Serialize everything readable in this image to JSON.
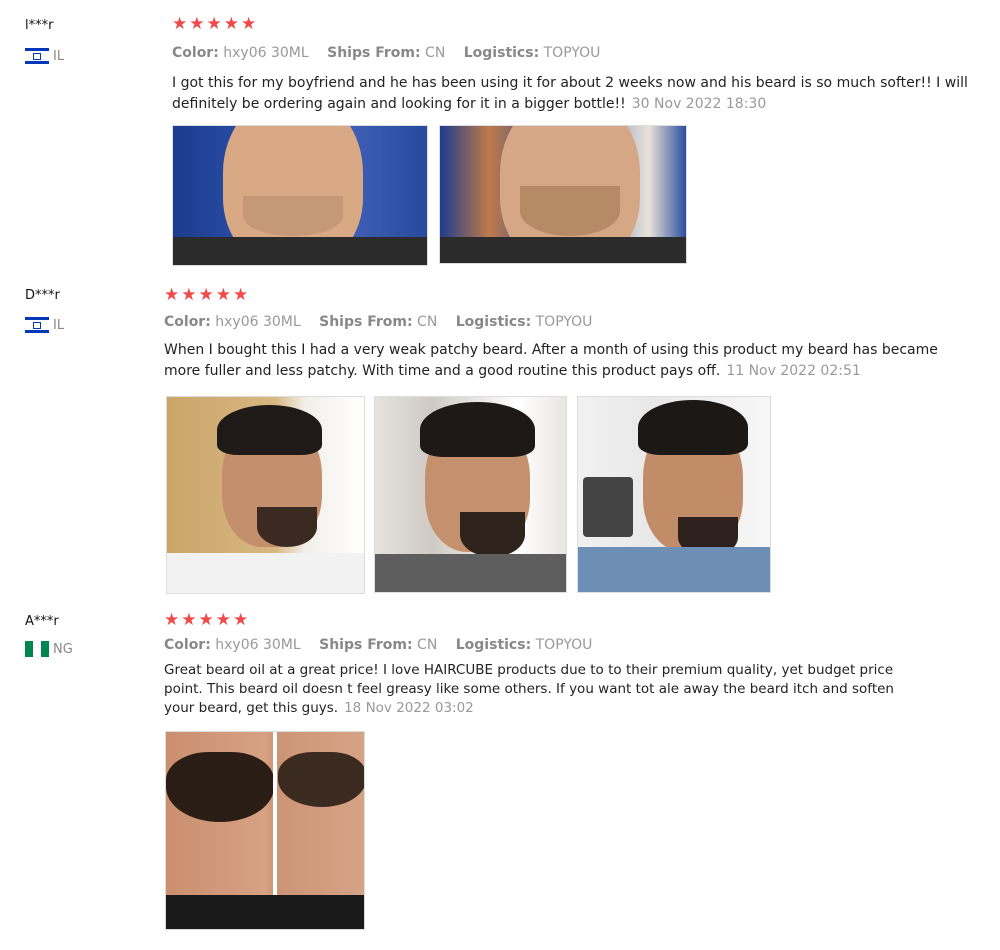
{
  "reviews": [
    {
      "user": "l***r",
      "country_code": "IL",
      "stars": "★★★★★",
      "color_label": "Color:",
      "color_value": "hxy06 30ML",
      "ships_label": "Ships From:",
      "ships_value": "CN",
      "logistics_label": "Logistics:",
      "logistics_value": "TOPYOU",
      "text": "I got this for my boyfriend and he has been using it for about 2 weeks now and his beard is so much softer!! I will definitely be ordering again and looking for it in a bigger bottle!!",
      "date": "30 Nov 2022 18:30",
      "photo_count": 2
    },
    {
      "user": "D***r",
      "country_code": "IL",
      "stars": "★★★★★",
      "color_label": "Color:",
      "color_value": "hxy06 30ML",
      "ships_label": "Ships From:",
      "ships_value": "CN",
      "logistics_label": "Logistics:",
      "logistics_value": "TOPYOU",
      "text": "When I bought this I had a very weak patchy beard. After a month of using this product my beard has became more fuller and less patchy. With time and a good routine this product pays off.",
      "date": "11 Nov 2022 02:51",
      "photo_count": 3
    },
    {
      "user": "A***r",
      "country_code": "NG",
      "stars": "★★★★★",
      "color_label": "Color:",
      "color_value": "hxy06 30ML",
      "ships_label": "Ships From:",
      "ships_value": "CN",
      "logistics_label": "Logistics:",
      "logistics_value": "TOPYOU",
      "text": "Great beard oil at a great price! I love HAIRCUBE products due to to their premium quality, yet budget price point. This beard oil doesn t feel greasy like some others. If you want tot ale away the beard itch and soften your beard, get this guys.",
      "date": "18 Nov 2022 03:02",
      "photo_count": 1
    }
  ],
  "colors": {
    "star": "#f04a4a",
    "meta": "#999999",
    "text": "#222222"
  }
}
